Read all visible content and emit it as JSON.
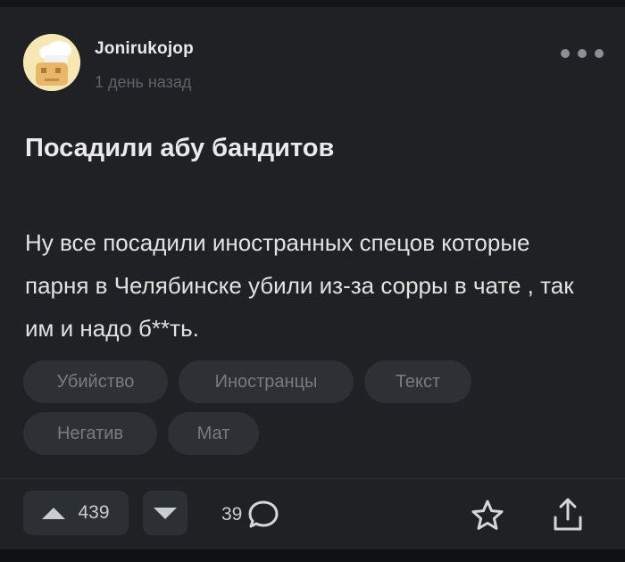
{
  "post": {
    "author": "Jonirukojop",
    "timestamp": "1 день назад",
    "title": "Посадили абу бандитов",
    "body": "Ну все посадили иностранных спецов которые парня в Челябинске убили из-за сорры в чате , так им и надо б**ть.",
    "tags": [
      "Убийство",
      "Иностранцы",
      "Текст",
      "Негатив",
      "Мат"
    ]
  },
  "actions": {
    "upvotes": "439",
    "comments": "39",
    "icons": [
      "more-icon",
      "upvote-icon",
      "downvote-icon",
      "comment-icon",
      "star-icon",
      "share-icon"
    ]
  },
  "colors": {
    "card_background": "#1f2124",
    "page_background": "#0e0f10",
    "tag_background": "#2d3034",
    "muted_text": "#777c82"
  }
}
